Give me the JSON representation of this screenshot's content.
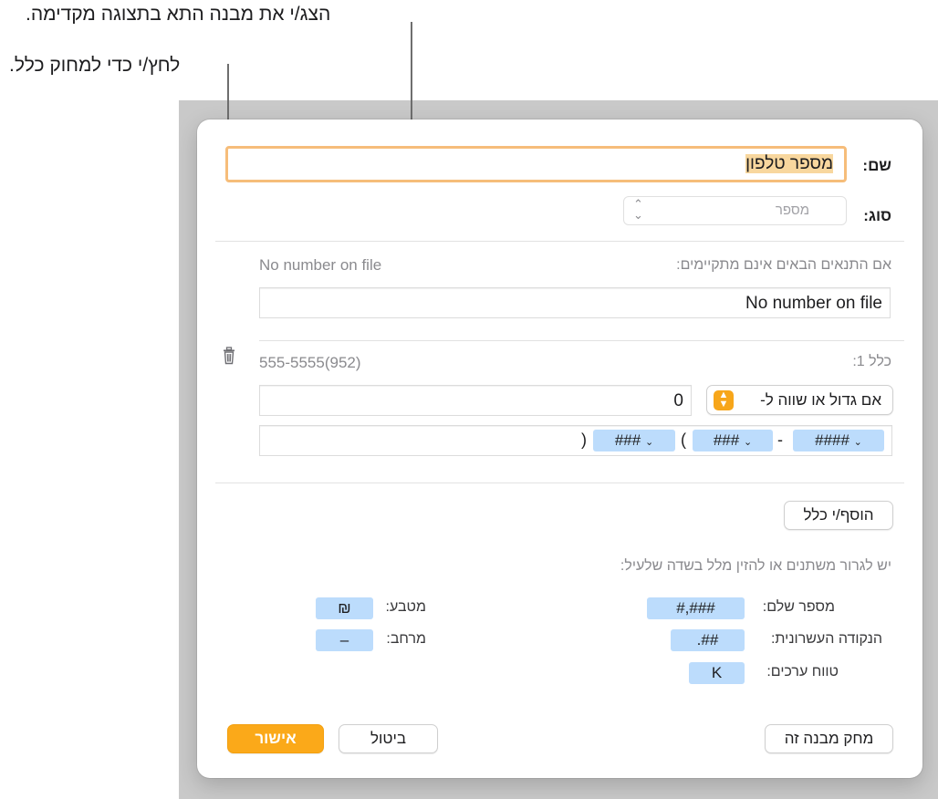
{
  "callouts": {
    "preview": "הצג/י את מבנה התא בתצוגה מקדימה.",
    "delete": "לחץ/י כדי למחוק כלל."
  },
  "dialog": {
    "name_label": "שם:",
    "name_value": "מספר טלפון",
    "type_label": "סוג:",
    "type_value": "מספר",
    "otherwise_label": "אם התנאים הבאים אינם מתקיימים:",
    "otherwise_preview": "No number on file",
    "otherwise_value": "No number on file",
    "rule": {
      "label": "כלל 1:",
      "preview": "555-5555(952)",
      "condition": "אם גדול או שווה ל-",
      "condition_value": "0",
      "format_tokens": [
        "####",
        "###",
        "###"
      ],
      "format_dash": "-",
      "format_paren_open": "(",
      "format_paren_close": ")"
    },
    "add_rule": "הוסף/י כלל",
    "hint": "יש לגרור משתנים או להזין מלל בשדה שלעיל:",
    "elements": {
      "integer_label": "מספר שלם:",
      "integer_token": "#,###",
      "decimal_label": "הנקודה העשרונית:",
      "decimal_token": ".##",
      "scale_label": "טווח ערכים:",
      "scale_token": "K",
      "currency_label": "מטבע:",
      "currency_token": "₪",
      "space_label": "מרחב:",
      "space_token": "–"
    },
    "delete_format": "מחק מבנה זה",
    "cancel": "ביטול",
    "ok": "אישור"
  }
}
